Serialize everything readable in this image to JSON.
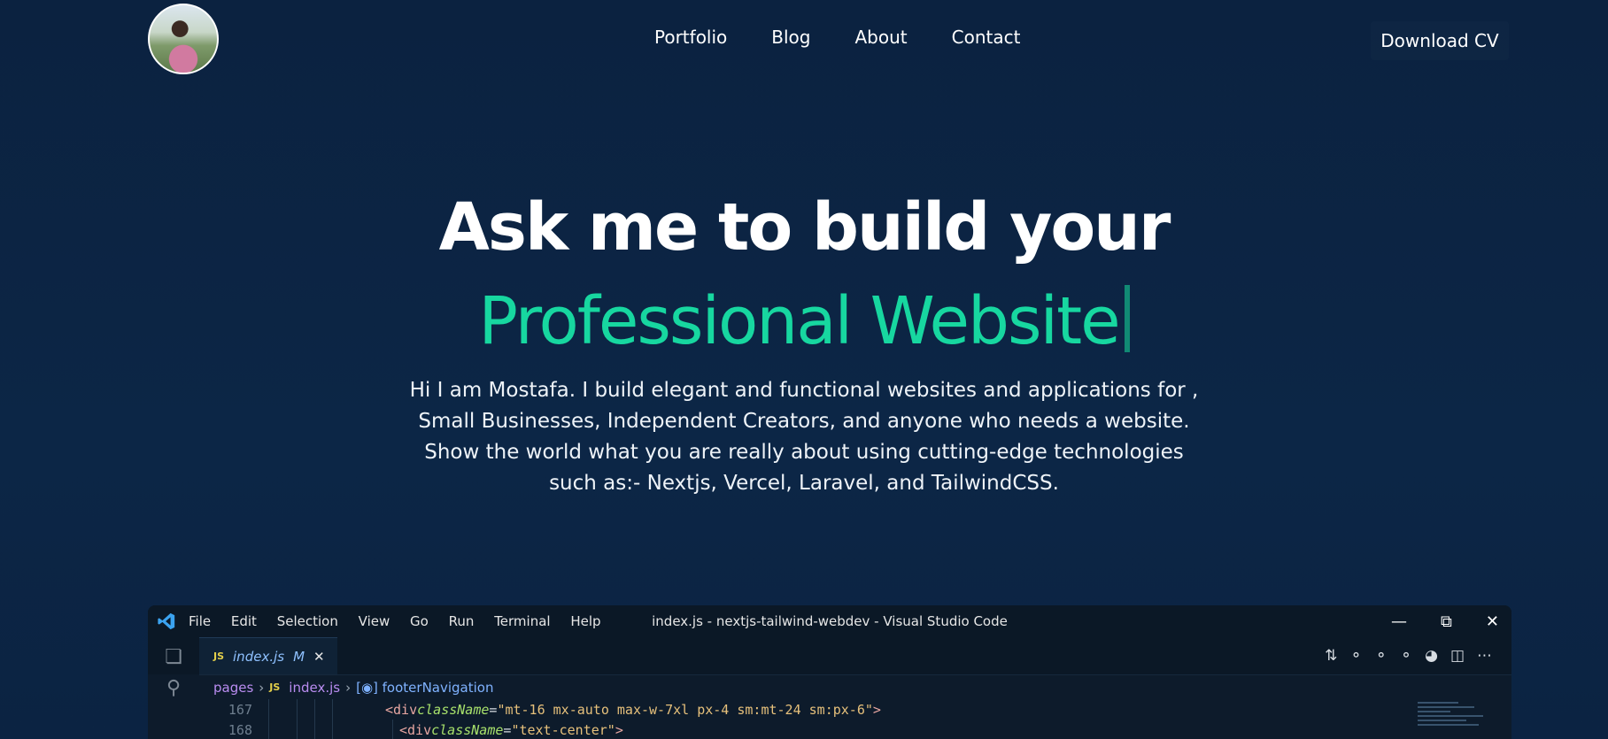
{
  "header": {
    "avatar_alt": "profile photo",
    "nav": [
      "Portfolio",
      "Blog",
      "About",
      "Contact"
    ],
    "download_label": "Download CV"
  },
  "hero": {
    "title_line1": "Ask me to build your",
    "title_line2": "Professional Website",
    "intro": "Hi I am Mostafa. I build elegant and functional websites and applications for , Small Businesses, Independent Creators, and anyone who needs a website. Show the world what you are really about using cutting-edge technologies such as:- Nextjs, Vercel, Laravel, and TailwindCSS."
  },
  "vscode": {
    "menu": [
      "File",
      "Edit",
      "Selection",
      "View",
      "Go",
      "Run",
      "Terminal",
      "Help"
    ],
    "window_title": "index.js - nextjs-tailwind-webdev - Visual Studio Code",
    "tab": {
      "badge": "JS",
      "name": "index.js",
      "status": "M"
    },
    "breadcrumb": {
      "folder": "pages",
      "badge": "JS",
      "file": "index.js",
      "symbol": "footerNavigation"
    },
    "lines": [
      {
        "num": "167",
        "tag_open": "<div ",
        "attr": "className",
        "eq": "=",
        "value": "\"mt-16 mx-auto max-w-7xl px-4 sm:mt-24 sm:px-6\"",
        "close": ">"
      },
      {
        "num": "168",
        "tag_open": "<div ",
        "attr": "className",
        "eq": "=",
        "value": "\"text-center\"",
        "close": ">"
      }
    ]
  },
  "colors": {
    "background": "#0b2240",
    "accent": "#17d7a0",
    "cursor": "#118a74"
  }
}
